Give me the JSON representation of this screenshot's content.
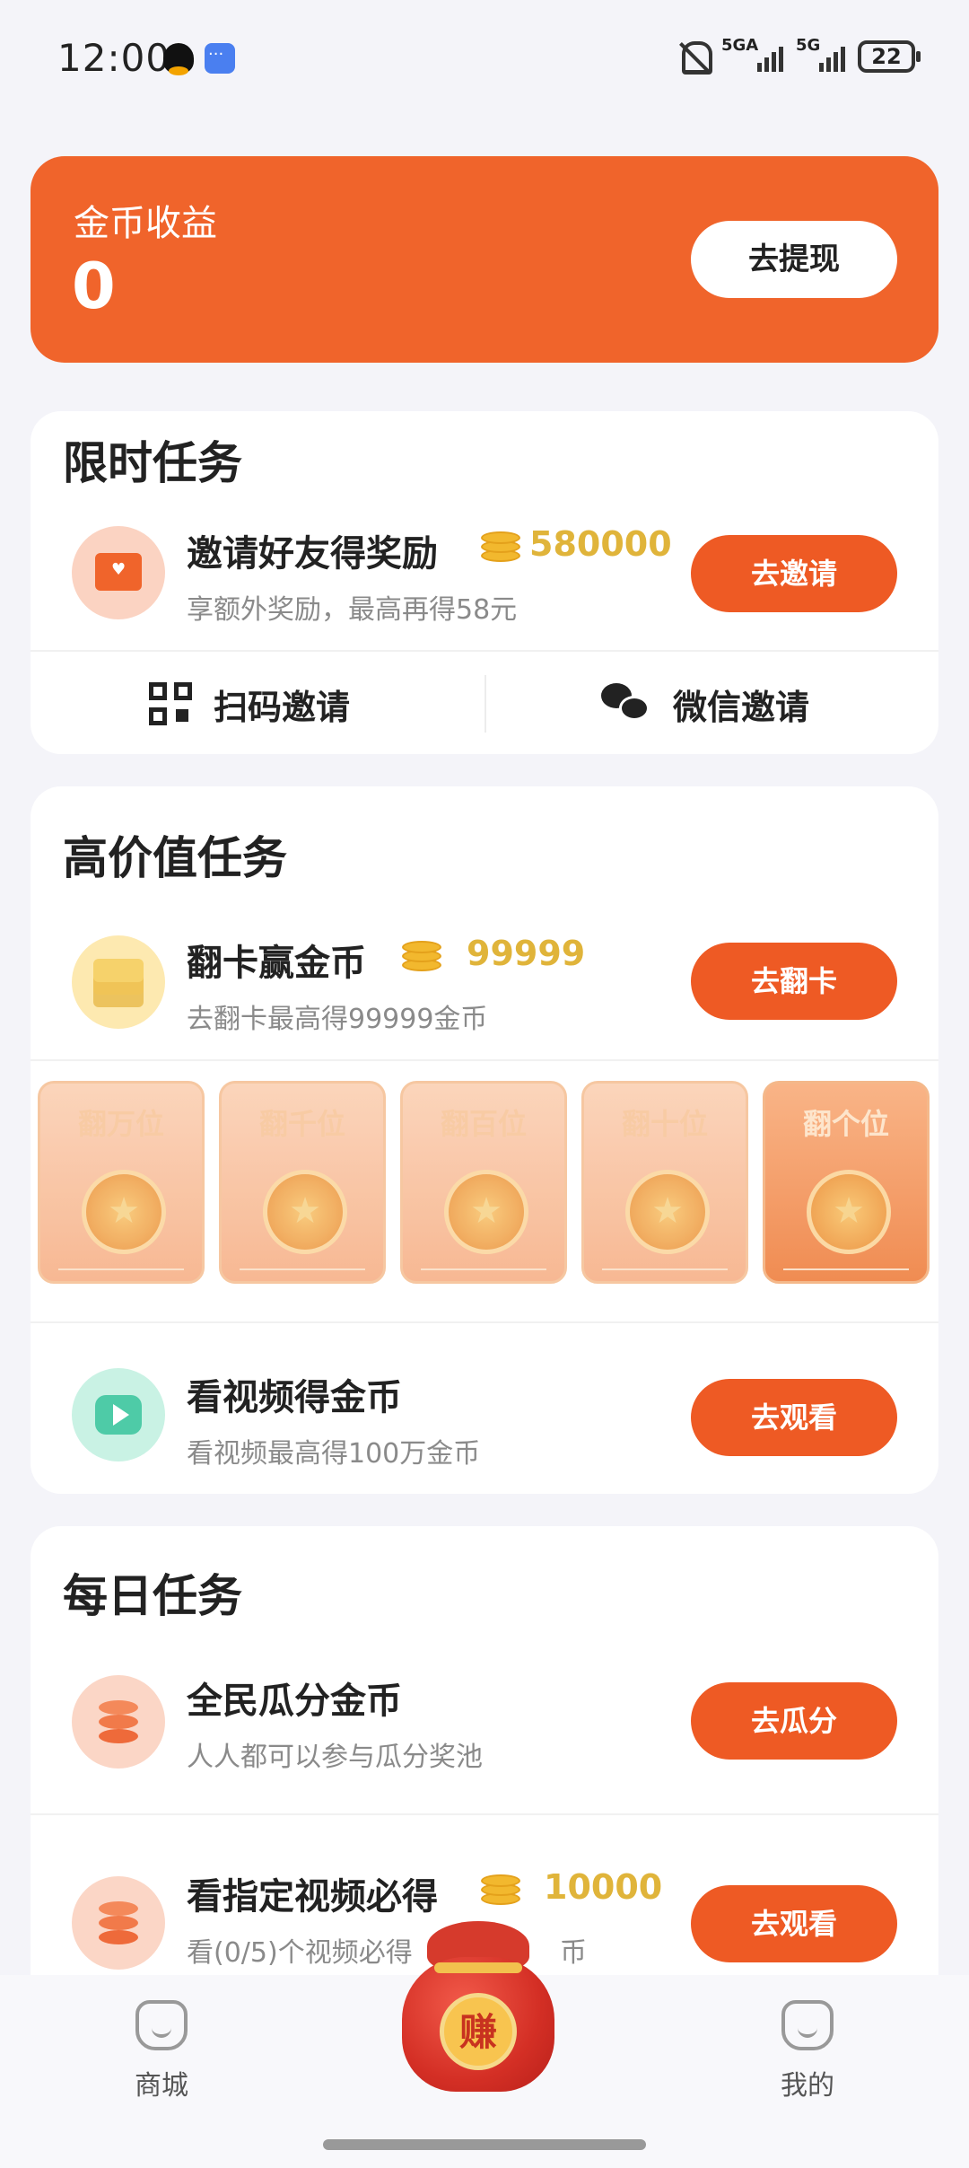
{
  "status_bar": {
    "time": "12:00",
    "net1": "5GA",
    "net2": "5G",
    "battery": "22"
  },
  "coin_card": {
    "title": "金币收益",
    "value": "0",
    "withdraw_label": "去提现"
  },
  "limited": {
    "title": "限时任务",
    "invite": {
      "name": "邀请好友得奖励",
      "reward": "580000",
      "desc": "享额外奖励，最高再得58元",
      "button": "去邀请"
    },
    "scan_label": "扫码邀请",
    "wechat_label": "微信邀请"
  },
  "high_value": {
    "title": "高价值任务",
    "flip": {
      "name": "翻卡赢金币",
      "reward": "99999",
      "desc": "去翻卡最高得99999金币",
      "button": "去翻卡"
    },
    "cards": [
      "翻万位",
      "翻千位",
      "翻百位",
      "翻十位",
      "翻个位"
    ],
    "video": {
      "name": "看视频得金币",
      "desc": "看视频最高得100万金币",
      "button": "去观看"
    }
  },
  "daily": {
    "title": "每日任务",
    "share": {
      "name": "全民瓜分金币",
      "desc": "人人都可以参与瓜分奖池",
      "button": "去瓜分"
    },
    "specified": {
      "name": "看指定视频必得",
      "reward": "10000",
      "desc": "看(0/5)个视频必得",
      "desc_tail": "币",
      "button": "去观看"
    }
  },
  "nav": {
    "mall": "商城",
    "earn": "赚",
    "mine": "我的"
  }
}
